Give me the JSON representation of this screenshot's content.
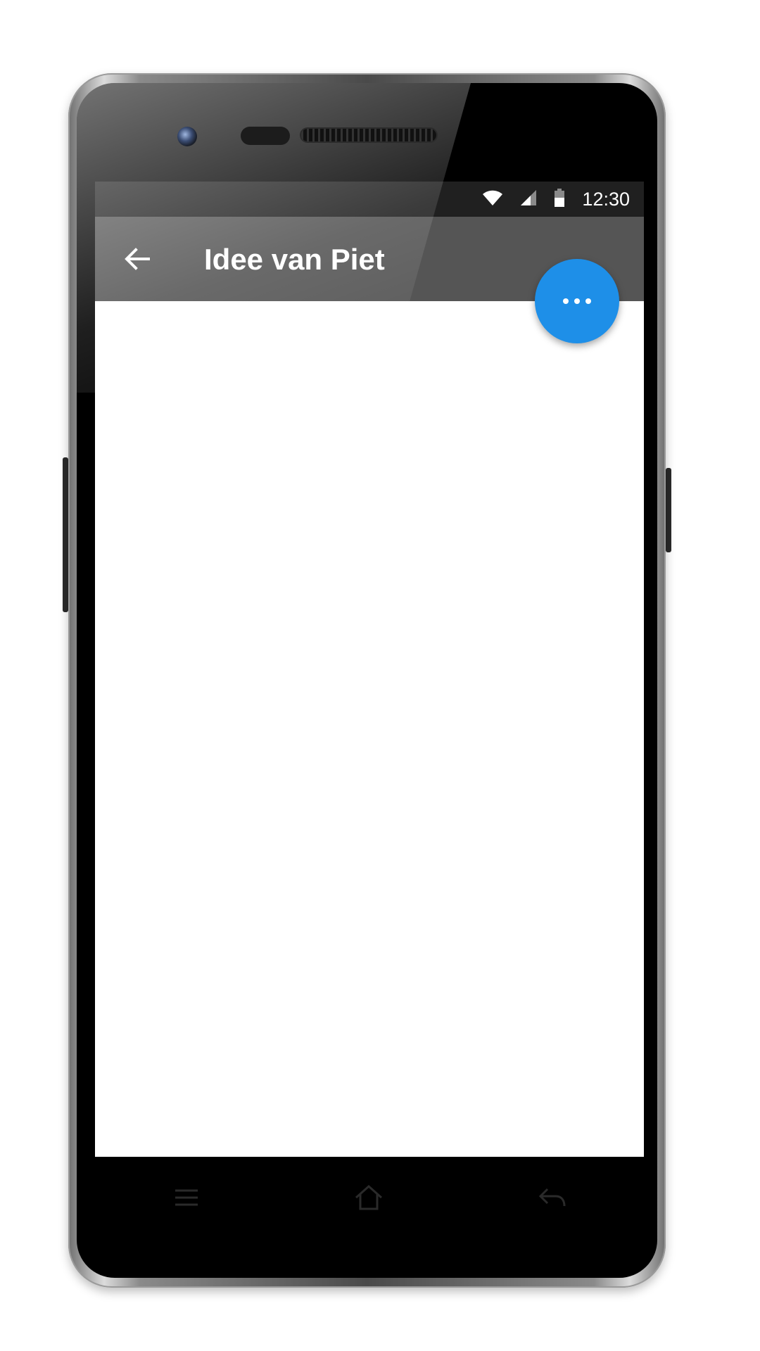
{
  "status_bar": {
    "time": "12:30",
    "icons": [
      "wifi-icon",
      "signal-icon",
      "battery-icon"
    ]
  },
  "app_bar": {
    "title": "Idee van Piet",
    "back_icon": "arrow-left-icon"
  },
  "fab": {
    "icon": "more-horizontal-icon",
    "color": "#1e8fe8"
  },
  "hardware_keys": [
    "menu-icon",
    "home-icon",
    "back-icon"
  ],
  "colors": {
    "app_bar": "#555555",
    "status_bar": "#202020",
    "content": "#ffffff"
  }
}
